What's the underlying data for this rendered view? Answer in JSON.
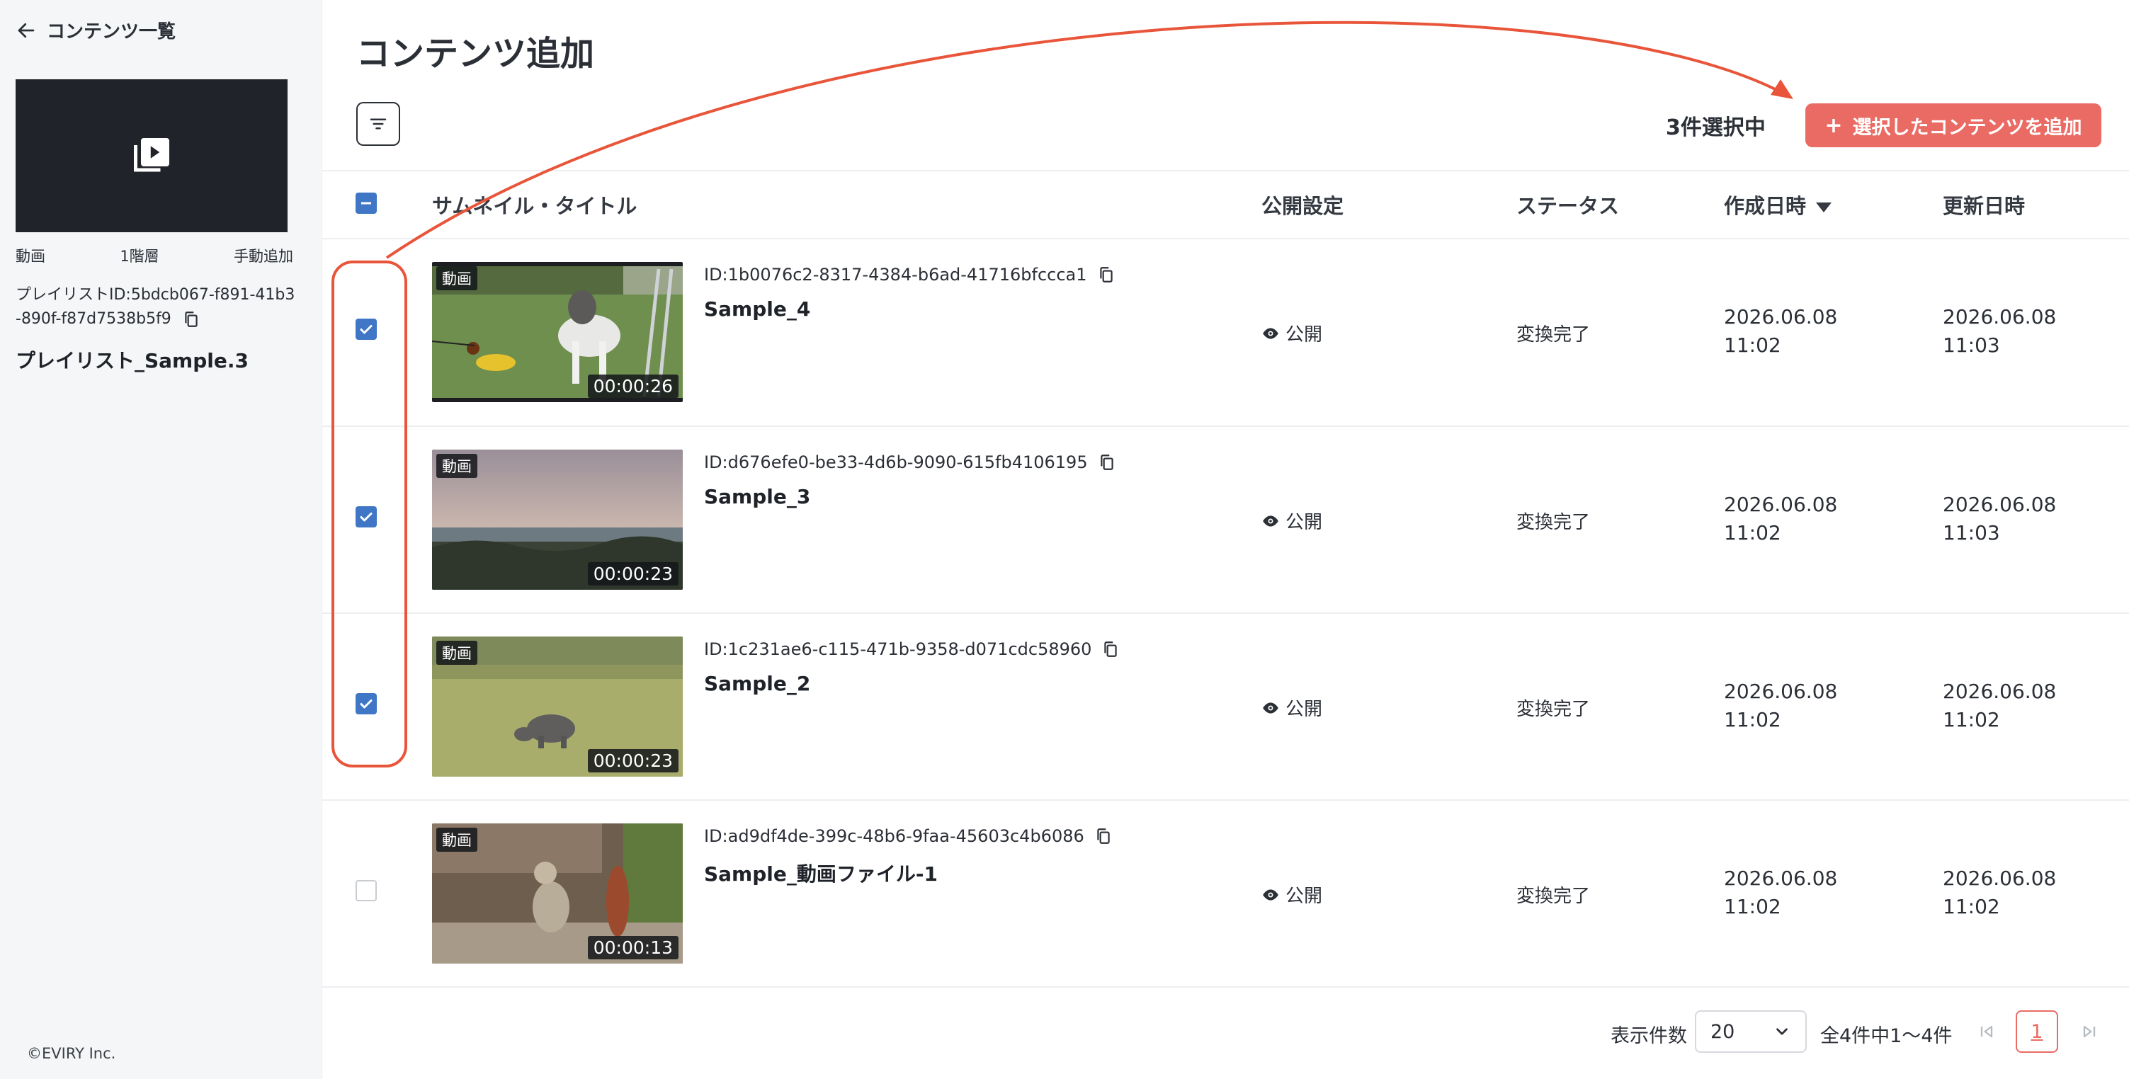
{
  "sidebar": {
    "back_label": "コンテンツ一覧",
    "meta": [
      "動画",
      "1階層",
      "手動追加"
    ],
    "playlist_id_line1": "プレイリストID:5bdcb067-f891-41b3",
    "playlist_id_line2": "-890f-f87d7538b5f9",
    "playlist_name": "プレイリスト_Sample.3",
    "copyright": "©EVIRY Inc."
  },
  "header": {
    "title": "コンテンツ追加",
    "selected_count": "3件選択中",
    "add_button_plus": "+",
    "add_button_label": "選択したコンテンツを追加"
  },
  "table": {
    "columns": {
      "thumb_title": "サムネイル・タイトル",
      "publish": "公開設定",
      "status": "ステータス",
      "created": "作成日時",
      "updated": "更新日時"
    },
    "rows": [
      {
        "checked": true,
        "tag": "動画",
        "duration": "00:00:26",
        "id": "ID:1b0076c2-8317-4384-b6ad-41716bfccca1",
        "title": "Sample_4",
        "publish": "公開",
        "status": "変換完了",
        "created_date": "2026.06.08",
        "created_time": "11:02",
        "updated_date": "2026.06.08",
        "updated_time": "11:03"
      },
      {
        "checked": true,
        "tag": "動画",
        "duration": "00:00:23",
        "id": "ID:d676efe0-be33-4d6b-9090-615fb4106195",
        "title": "Sample_3",
        "publish": "公開",
        "status": "変換完了",
        "created_date": "2026.06.08",
        "created_time": "11:02",
        "updated_date": "2026.06.08",
        "updated_time": "11:03"
      },
      {
        "checked": true,
        "tag": "動画",
        "duration": "00:00:23",
        "id": "ID:1c231ae6-c115-471b-9358-d071cdc58960",
        "title": "Sample_2",
        "publish": "公開",
        "status": "変換完了",
        "created_date": "2026.06.08",
        "created_time": "11:02",
        "updated_date": "2026.06.08",
        "updated_time": "11:02"
      },
      {
        "checked": false,
        "tag": "動画",
        "duration": "00:00:13",
        "id": "ID:ad9df4de-399c-48b6-9faa-45603c4b6086",
        "title": "Sample_動画ファイル-1",
        "publish": "公開",
        "status": "変換完了",
        "created_date": "2026.06.08",
        "created_time": "11:02",
        "updated_date": "2026.06.08",
        "updated_time": "11:02"
      }
    ]
  },
  "pagination": {
    "per_page_label": "表示件数",
    "per_page_value": "20",
    "range_text": "全4件中1〜4件",
    "current_page": "1"
  },
  "colors": {
    "accent": "#e96b64",
    "checkbox": "#3f77c6",
    "annotation": "#e8553a"
  }
}
